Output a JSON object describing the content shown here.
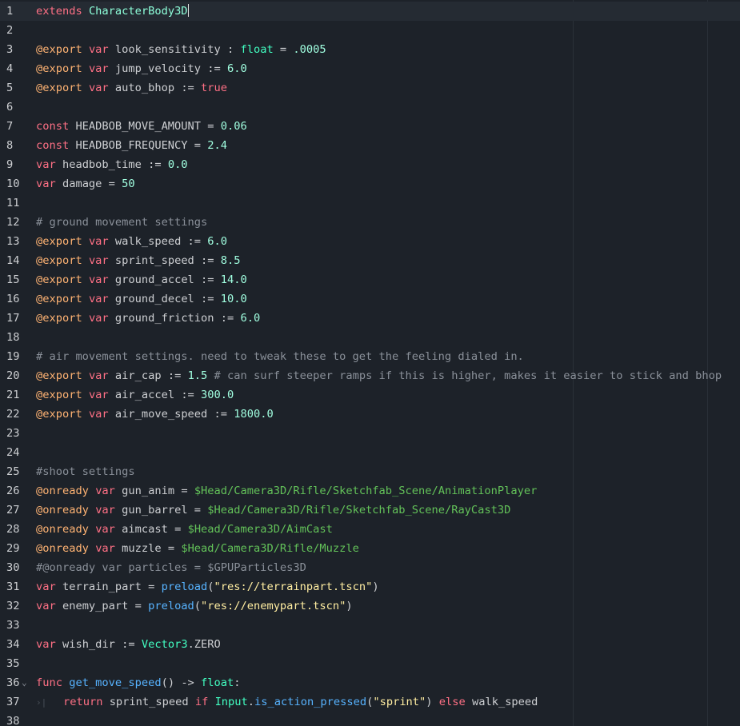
{
  "editor": {
    "current_line": "1",
    "lines": [
      {
        "n": "1",
        "tokens": [
          {
            "t": "extends",
            "c": "kw"
          },
          {
            "t": " "
          },
          {
            "t": "CharacterBody3D",
            "c": "cls"
          }
        ],
        "caret": true
      },
      {
        "n": "2",
        "tokens": []
      },
      {
        "n": "3",
        "tokens": [
          {
            "t": "@export",
            "c": "ann"
          },
          {
            "t": " "
          },
          {
            "t": "var",
            "c": "kw"
          },
          {
            "t": " look_sensitivity : "
          },
          {
            "t": "float",
            "c": "type"
          },
          {
            "t": " = "
          },
          {
            "t": ".0005",
            "c": "num"
          }
        ]
      },
      {
        "n": "4",
        "tokens": [
          {
            "t": "@export",
            "c": "ann"
          },
          {
            "t": " "
          },
          {
            "t": "var",
            "c": "kw"
          },
          {
            "t": " jump_velocity := "
          },
          {
            "t": "6.0",
            "c": "num"
          }
        ]
      },
      {
        "n": "5",
        "tokens": [
          {
            "t": "@export",
            "c": "ann"
          },
          {
            "t": " "
          },
          {
            "t": "var",
            "c": "kw"
          },
          {
            "t": " auto_bhop := "
          },
          {
            "t": "true",
            "c": "kw"
          }
        ]
      },
      {
        "n": "6",
        "tokens": []
      },
      {
        "n": "7",
        "tokens": [
          {
            "t": "const",
            "c": "kw"
          },
          {
            "t": " HEADBOB_MOVE_AMOUNT = "
          },
          {
            "t": "0.06",
            "c": "num"
          }
        ]
      },
      {
        "n": "8",
        "tokens": [
          {
            "t": "const",
            "c": "kw"
          },
          {
            "t": " HEADBOB_FREQUENCY = "
          },
          {
            "t": "2.4",
            "c": "num"
          }
        ]
      },
      {
        "n": "9",
        "tokens": [
          {
            "t": "var",
            "c": "kw"
          },
          {
            "t": " headbob_time := "
          },
          {
            "t": "0.0",
            "c": "num"
          }
        ]
      },
      {
        "n": "10",
        "tokens": [
          {
            "t": "var",
            "c": "kw"
          },
          {
            "t": " damage = "
          },
          {
            "t": "50",
            "c": "num"
          }
        ]
      },
      {
        "n": "11",
        "tokens": []
      },
      {
        "n": "12",
        "tokens": [
          {
            "t": "# ground movement settings",
            "c": "cmt"
          }
        ]
      },
      {
        "n": "13",
        "tokens": [
          {
            "t": "@export",
            "c": "ann"
          },
          {
            "t": " "
          },
          {
            "t": "var",
            "c": "kw"
          },
          {
            "t": " walk_speed := "
          },
          {
            "t": "6.0",
            "c": "num"
          }
        ]
      },
      {
        "n": "14",
        "tokens": [
          {
            "t": "@export",
            "c": "ann"
          },
          {
            "t": " "
          },
          {
            "t": "var",
            "c": "kw"
          },
          {
            "t": " sprint_speed := "
          },
          {
            "t": "8.5",
            "c": "num"
          }
        ]
      },
      {
        "n": "15",
        "tokens": [
          {
            "t": "@export",
            "c": "ann"
          },
          {
            "t": " "
          },
          {
            "t": "var",
            "c": "kw"
          },
          {
            "t": " ground_accel := "
          },
          {
            "t": "14.0",
            "c": "num"
          }
        ]
      },
      {
        "n": "16",
        "tokens": [
          {
            "t": "@export",
            "c": "ann"
          },
          {
            "t": " "
          },
          {
            "t": "var",
            "c": "kw"
          },
          {
            "t": " ground_decel := "
          },
          {
            "t": "10.0",
            "c": "num"
          }
        ]
      },
      {
        "n": "17",
        "tokens": [
          {
            "t": "@export",
            "c": "ann"
          },
          {
            "t": " "
          },
          {
            "t": "var",
            "c": "kw"
          },
          {
            "t": " ground_friction := "
          },
          {
            "t": "6.0",
            "c": "num"
          }
        ]
      },
      {
        "n": "18",
        "tokens": []
      },
      {
        "n": "19",
        "tokens": [
          {
            "t": "# air movement settings. need to tweak these to get the feeling dialed in.",
            "c": "cmt"
          }
        ]
      },
      {
        "n": "20",
        "tokens": [
          {
            "t": "@export",
            "c": "ann"
          },
          {
            "t": " "
          },
          {
            "t": "var",
            "c": "kw"
          },
          {
            "t": " air_cap := "
          },
          {
            "t": "1.5",
            "c": "num"
          },
          {
            "t": " "
          },
          {
            "t": "# can surf steeper ramps if this is higher, makes it easier to stick and bhop",
            "c": "cmt"
          }
        ]
      },
      {
        "n": "21",
        "tokens": [
          {
            "t": "@export",
            "c": "ann"
          },
          {
            "t": " "
          },
          {
            "t": "var",
            "c": "kw"
          },
          {
            "t": " air_accel := "
          },
          {
            "t": "300.0",
            "c": "num"
          }
        ]
      },
      {
        "n": "22",
        "tokens": [
          {
            "t": "@export",
            "c": "ann"
          },
          {
            "t": " "
          },
          {
            "t": "var",
            "c": "kw"
          },
          {
            "t": " air_move_speed := "
          },
          {
            "t": "1800.0",
            "c": "num"
          }
        ]
      },
      {
        "n": "23",
        "tokens": []
      },
      {
        "n": "24",
        "tokens": []
      },
      {
        "n": "25",
        "tokens": [
          {
            "t": "#shoot settings",
            "c": "cmt"
          }
        ]
      },
      {
        "n": "26",
        "tokens": [
          {
            "t": "@onready",
            "c": "ann"
          },
          {
            "t": " "
          },
          {
            "t": "var",
            "c": "kw"
          },
          {
            "t": " gun_anim = "
          },
          {
            "t": "$Head/Camera3D/Rifle/Sketchfab_Scene/AnimationPlayer",
            "c": "node"
          }
        ]
      },
      {
        "n": "27",
        "tokens": [
          {
            "t": "@onready",
            "c": "ann"
          },
          {
            "t": " "
          },
          {
            "t": "var",
            "c": "kw"
          },
          {
            "t": " gun_barrel = "
          },
          {
            "t": "$Head/Camera3D/Rifle/Sketchfab_Scene/RayCast3D",
            "c": "node"
          }
        ]
      },
      {
        "n": "28",
        "tokens": [
          {
            "t": "@onready",
            "c": "ann"
          },
          {
            "t": " "
          },
          {
            "t": "var",
            "c": "kw"
          },
          {
            "t": " aimcast = "
          },
          {
            "t": "$Head/Camera3D/AimCast",
            "c": "node"
          }
        ]
      },
      {
        "n": "29",
        "tokens": [
          {
            "t": "@onready",
            "c": "ann"
          },
          {
            "t": " "
          },
          {
            "t": "var",
            "c": "kw"
          },
          {
            "t": " muzzle = "
          },
          {
            "t": "$Head/Camera3D/Rifle/Muzzle",
            "c": "node"
          }
        ]
      },
      {
        "n": "30",
        "tokens": [
          {
            "t": "#@onready var particles = $GPUParticles3D",
            "c": "cmt"
          }
        ]
      },
      {
        "n": "31",
        "tokens": [
          {
            "t": "var",
            "c": "kw"
          },
          {
            "t": " terrain_part = "
          },
          {
            "t": "preload",
            "c": "fn"
          },
          {
            "t": "("
          },
          {
            "t": "\"res://terrainpart.tscn\"",
            "c": "str"
          },
          {
            "t": ")"
          }
        ]
      },
      {
        "n": "32",
        "tokens": [
          {
            "t": "var",
            "c": "kw"
          },
          {
            "t": " enemy_part = "
          },
          {
            "t": "preload",
            "c": "fn"
          },
          {
            "t": "("
          },
          {
            "t": "\"res://enemypart.tscn\"",
            "c": "str"
          },
          {
            "t": ")"
          }
        ]
      },
      {
        "n": "33",
        "tokens": []
      },
      {
        "n": "34",
        "tokens": [
          {
            "t": "var",
            "c": "kw"
          },
          {
            "t": " wish_dir := "
          },
          {
            "t": "Vector3",
            "c": "type"
          },
          {
            "t": ".ZERO"
          }
        ]
      },
      {
        "n": "35",
        "tokens": []
      },
      {
        "n": "36",
        "tokens": [
          {
            "t": "func",
            "c": "kw"
          },
          {
            "t": " "
          },
          {
            "t": "get_move_speed",
            "c": "fn"
          },
          {
            "t": "() -> "
          },
          {
            "t": "float",
            "c": "type"
          },
          {
            "t": ":"
          }
        ],
        "fold": true
      },
      {
        "n": "37",
        "tokens": [
          {
            "t": "return",
            "c": "kw"
          },
          {
            "t": " sprint_speed "
          },
          {
            "t": "if",
            "c": "kw"
          },
          {
            "t": " "
          },
          {
            "t": "Input",
            "c": "type"
          },
          {
            "t": "."
          },
          {
            "t": "is_action_pressed",
            "c": "fn"
          },
          {
            "t": "("
          },
          {
            "t": "\"sprint\"",
            "c": "str"
          },
          {
            "t": ") "
          },
          {
            "t": "else",
            "c": "kw"
          },
          {
            "t": " walk_speed"
          }
        ],
        "indent": true
      },
      {
        "n": "38",
        "tokens": []
      }
    ]
  },
  "icons": {
    "fold": "chevron-down-icon",
    "indent": "tab-indent-icon"
  }
}
